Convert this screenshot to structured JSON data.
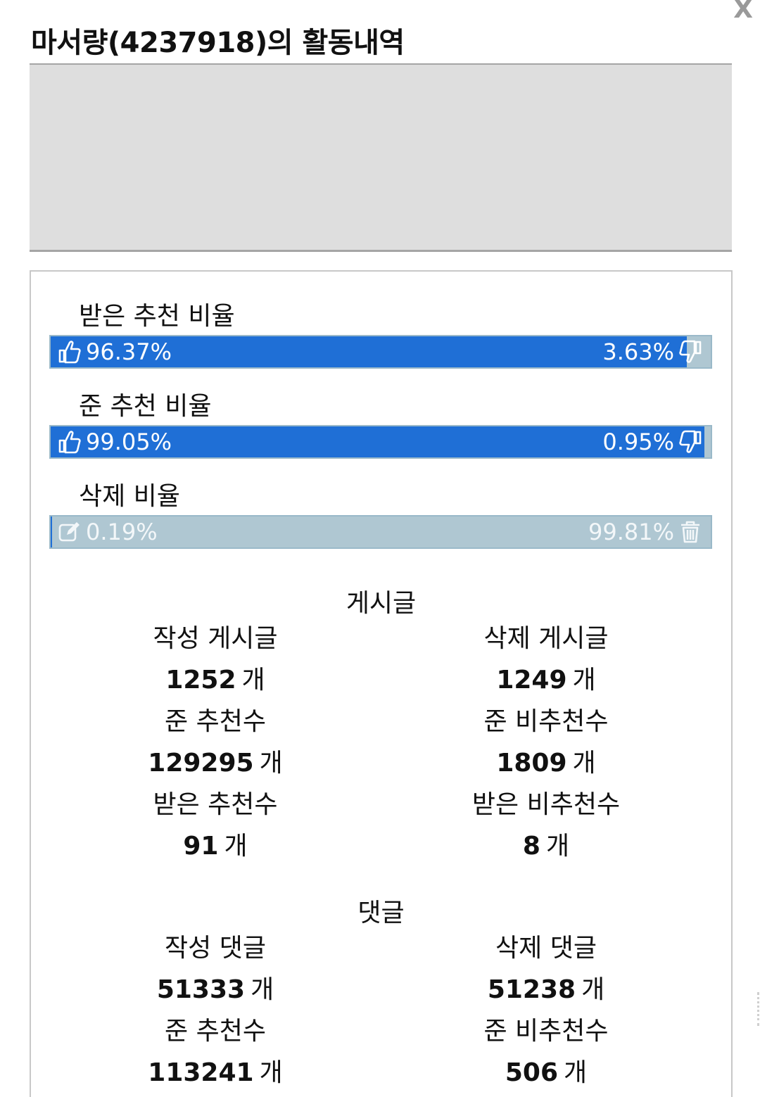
{
  "title": "마서량(4237918)의 활동내역",
  "close_label": "X",
  "ratios": [
    {
      "label": "받은 추천 비율",
      "left_value": "96.37%",
      "right_value": "3.63%",
      "fill_fraction": 0.9637,
      "left_icon": "thumbs-up-icon",
      "right_icon": "thumbs-down-icon"
    },
    {
      "label": "준 추천 비율",
      "left_value": "99.05%",
      "right_value": "0.95%",
      "fill_fraction": 0.9905,
      "left_icon": "thumbs-up-icon",
      "right_icon": "thumbs-down-icon"
    },
    {
      "label": "삭제 비율",
      "left_value": "0.19%",
      "right_value": "99.81%",
      "fill_fraction": 0.0019,
      "left_icon": "edit-icon",
      "right_icon": "trash-icon"
    }
  ],
  "posts": {
    "title": "게시글",
    "left": [
      {
        "label": "작성 게시글",
        "value": "1252",
        "unit": "개"
      },
      {
        "label": "준 추천수",
        "value": "129295",
        "unit": "개"
      },
      {
        "label": "받은 추천수",
        "value": "91",
        "unit": "개"
      }
    ],
    "right": [
      {
        "label": "삭제 게시글",
        "value": "1249",
        "unit": "개"
      },
      {
        "label": "준 비추천수",
        "value": "1809",
        "unit": "개"
      },
      {
        "label": "받은 비추천수",
        "value": "8",
        "unit": "개"
      }
    ]
  },
  "comments": {
    "title": "댓글",
    "left": [
      {
        "label": "작성 댓글",
        "value": "51333",
        "unit": "개"
      },
      {
        "label": "준 추천수",
        "value": "113241",
        "unit": "개"
      }
    ],
    "right": [
      {
        "label": "삭제 댓글",
        "value": "51238",
        "unit": "개"
      },
      {
        "label": "준 비추천수",
        "value": "506",
        "unit": "개"
      }
    ]
  },
  "colors": {
    "bar_fill": "#1f6fd6",
    "bar_track": "#afc7d2"
  }
}
